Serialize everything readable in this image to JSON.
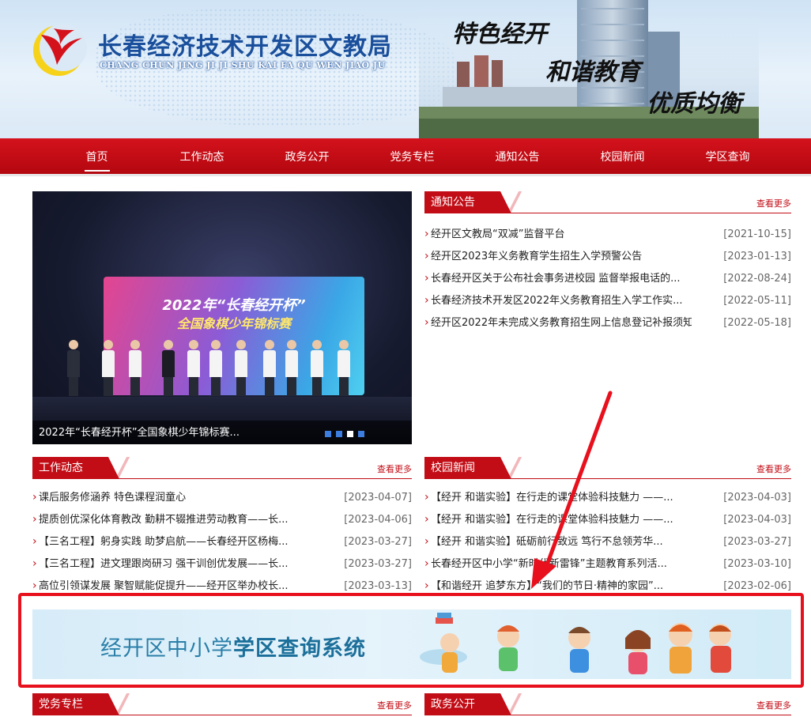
{
  "header": {
    "title": "长春经济技术开发区文教局",
    "subtitle": "CHANG CHUN JING JI JI SHU KAI FA QU WEN JIAO JU",
    "slogans": [
      "特色经开",
      "和谐教育",
      "优质均衡"
    ]
  },
  "nav": {
    "items": [
      "首页",
      "工作动态",
      "政务公开",
      "党务专栏",
      "通知公告",
      "校园新闻",
      "学区查询"
    ]
  },
  "carousel": {
    "caption": "2022年“长春经开杯”全国象棋少年锦标赛...",
    "screen_line1": "2022年“长春经开杯”",
    "screen_line2": "全国象棋少年锦标赛"
  },
  "notices": {
    "title": "通知公告",
    "more": "查看更多",
    "items": [
      {
        "text": "经开区文教局“双减”监督平台",
        "date": "[2021-10-15]"
      },
      {
        "text": "经开区2023年义务教育学生招生入学预警公告",
        "date": "[2023-01-13]"
      },
      {
        "text": "长春经开区关于公布社会事务进校园 监督举报电话的...",
        "date": "[2022-08-24]"
      },
      {
        "text": "长春经济技术开发区2022年义务教育招生入学工作实...",
        "date": "[2022-05-11]"
      },
      {
        "text": "经开区2022年未完成义务教育招生网上信息登记补报须知",
        "date": "[2022-05-18]"
      }
    ]
  },
  "work": {
    "title": "工作动态",
    "more": "查看更多",
    "items": [
      {
        "text": "课后服务修涵养 特色课程润童心",
        "date": "[2023-04-07]"
      },
      {
        "text": "提质创优深化体育教改 勤耕不辍推进劳动教育——长...",
        "date": "[2023-04-06]"
      },
      {
        "text": "【三名工程】躬身实践 助梦启航——长春经开区杨梅...",
        "date": "[2023-03-27]"
      },
      {
        "text": "【三名工程】进文理跟岗研习 强干训创优发展——长...",
        "date": "[2023-03-27]"
      },
      {
        "text": "高位引领谋发展 聚智赋能促提升——经开区举办校长...",
        "date": "[2023-03-13]"
      }
    ]
  },
  "campus": {
    "title": "校园新闻",
    "more": "查看更多",
    "items": [
      {
        "text": "【经开 和谐实验】在行走的课堂体验科技魅力 ——...",
        "date": "[2023-04-03]"
      },
      {
        "text": "【经开 和谐实验】在行走的课堂体验科技魅力 ——...",
        "date": "[2023-04-03]"
      },
      {
        "text": "【经开 和谐实验】砥砺前行致远 笃行不怠领芳华...",
        "date": "[2023-03-27]"
      },
      {
        "text": "长春经开区中小学“新时代新雷锋”主题教育系列活...",
        "date": "[2023-03-10]"
      },
      {
        "text": "【和谐经开 追梦东方】“我们的节日·精神的家园”...",
        "date": "[2023-02-06]"
      }
    ]
  },
  "banner": {
    "text_plain": "经开区中小学",
    "text_bold": "学区查询系统"
  },
  "party": {
    "title": "党务专栏",
    "more": "查看更多"
  },
  "gov": {
    "title": "政务公开",
    "more": "查看更多"
  },
  "colors": {
    "primary_red": "#c20d16",
    "nav_red": "#d4121c",
    "title_blue": "#1a4f9c",
    "annotation_red": "#e8101d"
  }
}
